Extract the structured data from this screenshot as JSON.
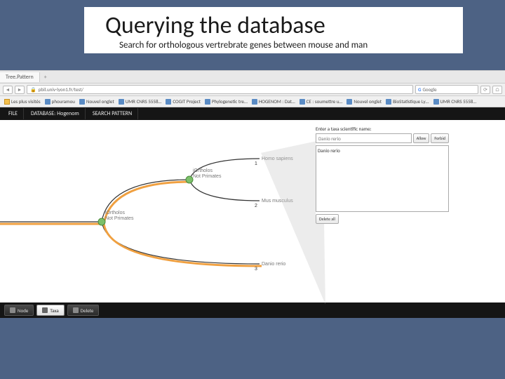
{
  "slide": {
    "title": "Querying the database",
    "subtitle": "Search for orthologous vertrebrate genes between mouse and man"
  },
  "browser": {
    "tab_title": "Tree.Pattern",
    "url": "pbil.univ-lyon1.fr/test/",
    "search_engine": "Google",
    "bookmarks": [
      "Les plus visités",
      "phouramou",
      "Nouvel onglet",
      "UMR CNRS 5558…",
      "COGIT Project",
      "Phylogenetic tre…",
      "HOGENOM : Dat…",
      "CE : soumettre u…",
      "Nouvel onglet",
      "BioStatistique Ly…",
      "UMR CNRS 5558…"
    ]
  },
  "app_menu": {
    "file": "FILE",
    "database": "DATABASE: Hogenom",
    "search": "SEARCH PATTERN"
  },
  "tree": {
    "root_label1": "iOrtholos",
    "root_label2": "Not Primates",
    "node1_label1": "iOrtholos",
    "node1_label2": "Not Primates",
    "leaf1": "Homo sapiens",
    "leaf1_num": "1",
    "leaf2": "Mus musculus",
    "leaf2_num": "2",
    "leaf3": "Danio rerio",
    "leaf3_num": "3"
  },
  "panel": {
    "label": "Enter a taxa scientific name:",
    "input_value": "Danio rerio",
    "allow_btn": "Allow",
    "forbid_btn": "Forbid",
    "list_item": "Danio rerio",
    "delete_btn": "Delete all"
  },
  "bottombar": {
    "node": "Node",
    "taxa": "Taxa",
    "delete": "Delete"
  }
}
